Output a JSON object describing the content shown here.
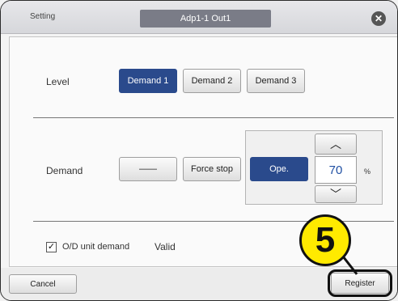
{
  "dialog": {
    "title_left": "Setting",
    "title_center": "Adp1-1 Out1",
    "close_symbol": "✕"
  },
  "level": {
    "label": "Level",
    "buttons": [
      "Demand 1",
      "Demand 2",
      "Demand 3"
    ],
    "selected": "Demand 1"
  },
  "demand": {
    "label": "Demand",
    "dash_label": "——",
    "force_stop_label": "Force stop",
    "ope_label": "Ope.",
    "value": "70",
    "unit": "%",
    "up_symbol": "︿",
    "down_symbol": "﹀"
  },
  "od": {
    "check_symbol": "✓",
    "label": "O/D unit demand",
    "status": "Valid"
  },
  "footer": {
    "cancel_label": "Cancel",
    "register_label": "Register"
  },
  "annotation": {
    "step_number": "5"
  },
  "colors": {
    "accent": "#2a4a8c",
    "badge": "#ffea00"
  }
}
